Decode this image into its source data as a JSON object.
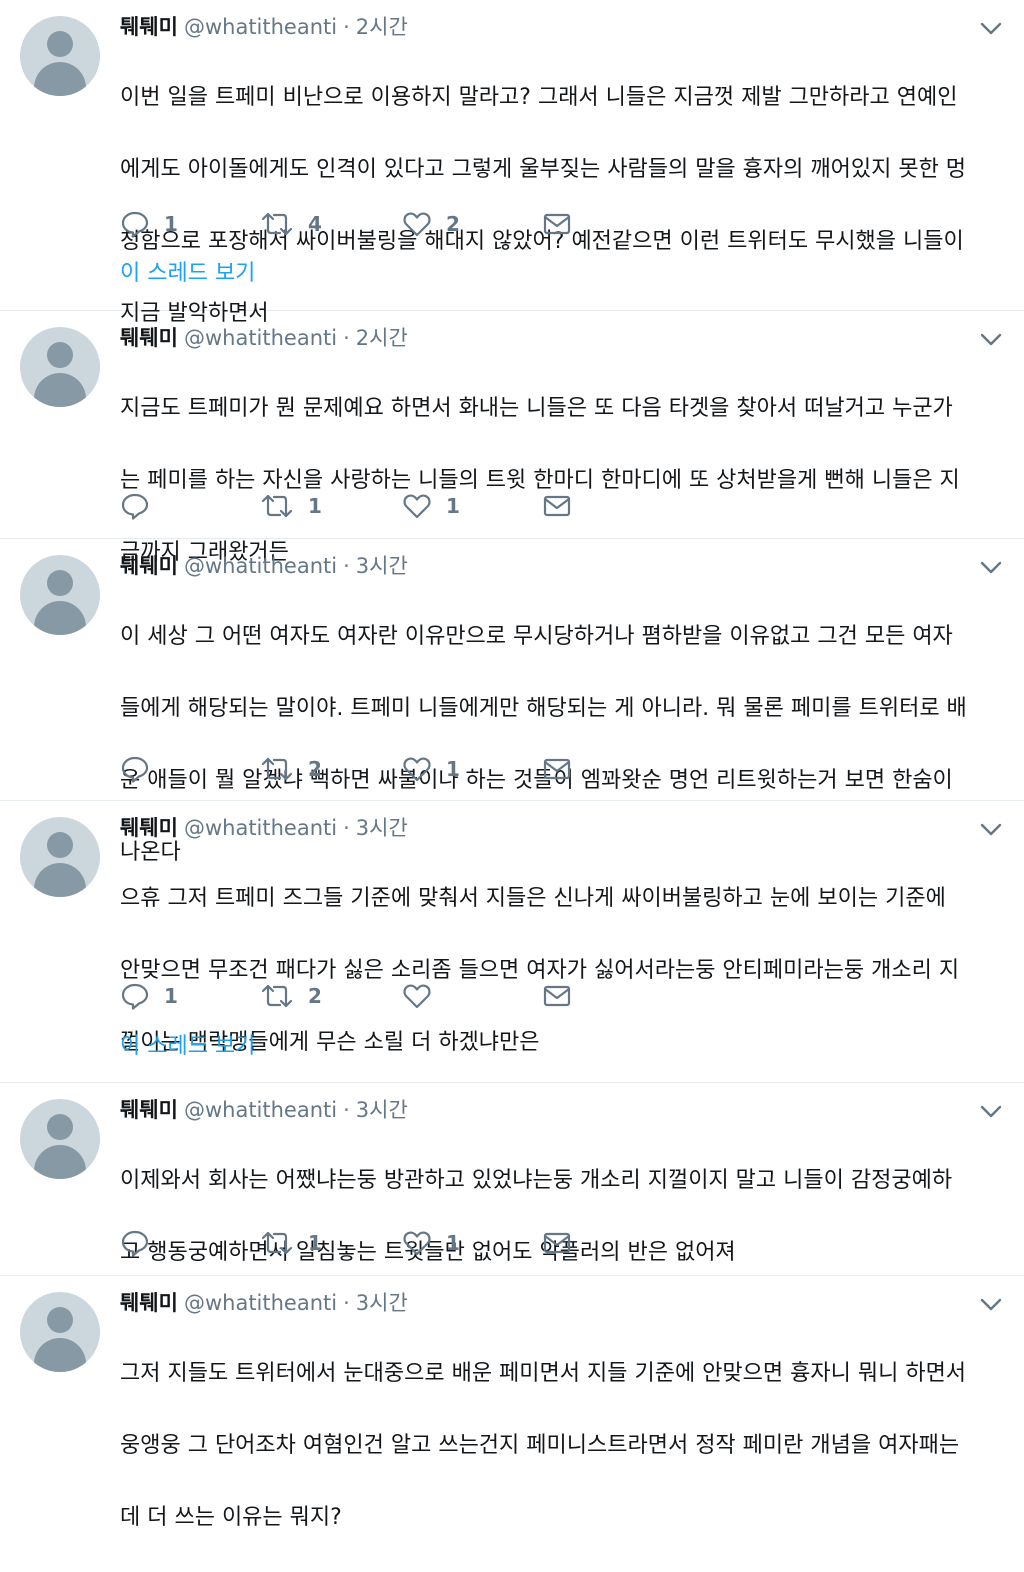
{
  "colors": {
    "accent": "#1da1f2",
    "secondary_text": "#657786",
    "divider": "#e6ecf0"
  },
  "icons": {
    "avatar": "default-avatar-icon",
    "caret": "chevron-down-icon",
    "reply": "reply-icon",
    "retweet": "retweet-icon",
    "like": "heart-icon",
    "dm": "direct-message-icon"
  },
  "tweets": [
    {
      "name": "퉤퉤미",
      "handle": "@whatitheanti",
      "sep": "·",
      "time": "2시간",
      "lines": [
        "이번 일을 트페미 비난으로 이용하지 말라고? 그래서 니들은 지금껏 제발 그만하라고 연예인",
        "에게도 아이돌에게도 인격이 있다고 그렇게 울부짖는 사람들의 말을 흉자의 깨어있지 못한 멍",
        "청함으로 포장해서 싸이버불링을 해대지 않았어? 예전같으면 이런 트위터도 무시했을 니들이",
        "지금 발악하면서"
      ],
      "replies": "1",
      "retweets": "4",
      "likes": "2",
      "thread_link": "이 스레드 보기"
    },
    {
      "name": "퉤퉤미",
      "handle": "@whatitheanti",
      "sep": "·",
      "time": "2시간",
      "lines": [
        "지금도 트페미가 뭔 문제예요 하면서 화내는 니들은 또 다음 타겟을 찾아서 떠날거고 누군가",
        "는 페미를 하는 자신을 사랑하는 니들의 트윗 한마디 한마디에 또 상처받을게 뻔해 니들은 지",
        "금까지 그래왔거든"
      ],
      "replies": "",
      "retweets": "1",
      "likes": "1",
      "thread_link": ""
    },
    {
      "name": "퉤퉤미",
      "handle": "@whatitheanti",
      "sep": "·",
      "time": "3시간",
      "lines": [
        "이 세상 그 어떤 여자도 여자란 이유만으로 무시당하거나 폄하받을 이유없고 그건 모든 여자",
        "들에게 해당되는 말이야. 트페미 니들에게만 해당되는 게 아니라. 뭐 물론 페미를 트위터로 배",
        "운 애들이 뭘 알겠냐 뻑하면 싸불이나 하는 것들이 엠꽈왓순 명언 리트윗하는거 보면 한숨이",
        "나온다"
      ],
      "replies": "",
      "retweets": "2",
      "likes": "1",
      "thread_link": ""
    },
    {
      "name": "퉤퉤미",
      "handle": "@whatitheanti",
      "sep": "·",
      "time": "3시간",
      "lines": [
        "으휴 그저 트페미 즈그들 기준에 맞춰서 지들은 신나게 싸이버불링하고 눈에 보이는 기준에",
        "안맞으면 무조건 패다가 싫은 소리좀 들으면 여자가 싫어서라는둥 안티페미라는둥 개소리 지",
        "껄이는 맥락맹들에게 무슨 소릴 더 하겠냐만은"
      ],
      "replies": "1",
      "retweets": "2",
      "likes": "",
      "thread_link": "이 스레드 보기"
    },
    {
      "name": "퉤퉤미",
      "handle": "@whatitheanti",
      "sep": "·",
      "time": "3시간",
      "lines": [
        "이제와서 회사는 어쨌냐는둥 방관하고 있었냐는둥 개소리 지껄이지 말고 니들이 감정궁예하",
        "고 행동궁예하면서 일침놓는 트윗들만 없어도 악플러의 반은 없어져"
      ],
      "replies": "",
      "retweets": "1",
      "likes": "1",
      "thread_link": ""
    },
    {
      "name": "퉤퉤미",
      "handle": "@whatitheanti",
      "sep": "·",
      "time": "3시간",
      "lines": [
        "그저 지들도 트위터에서 눈대중으로 배운 페미면서 지들 기준에 안맞으면 흉자니 뭐니 하면서",
        "웅앵웅 그 단어조차 여혐인건 알고 쓰는건지 페미니스트라면서 정작 페미란 개념을 여자패는",
        "데 더 쓰는 이유는 뭐지?"
      ],
      "replies": "",
      "retweets": "",
      "likes": "",
      "thread_link": ""
    }
  ]
}
